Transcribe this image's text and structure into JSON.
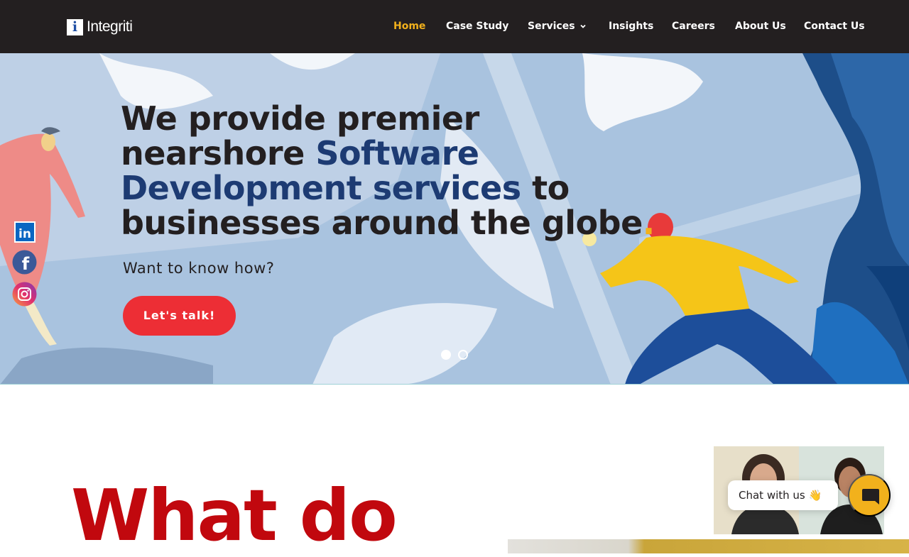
{
  "brand": {
    "logo_letter": "i",
    "name": "Integriti"
  },
  "nav": {
    "items": [
      {
        "label": "Home",
        "active": true
      },
      {
        "label": "Case Study"
      },
      {
        "label": "Services",
        "has_dropdown": true
      },
      {
        "label": "Insights"
      },
      {
        "label": "Careers"
      },
      {
        "label": "About Us"
      },
      {
        "label": "Contact Us"
      }
    ]
  },
  "hero": {
    "headline_a": "We provide premier",
    "headline_b": "nearshore ",
    "headline_hl_1": "Software",
    "headline_hl_2": "Development services",
    "headline_c": " to",
    "headline_d": "businesses around the globe",
    "headline_dot": ".",
    "subheading": "Want to know how?",
    "cta_label": "Let's talk!",
    "slides": 2,
    "active_slide": 1
  },
  "social": [
    {
      "name": "LinkedIn",
      "icon": "linkedin-icon",
      "text": "in"
    },
    {
      "name": "Facebook",
      "icon": "facebook-icon",
      "text": "f"
    },
    {
      "name": "Instagram",
      "icon": "instagram-icon"
    }
  ],
  "section": {
    "title": "What do"
  },
  "chat": {
    "label": "Chat with us",
    "emoji": "👋",
    "icon": "chat-bubble-icon"
  },
  "colors": {
    "nav_bg": "#231f20",
    "nav_active": "#f2b11c",
    "hero_bg": "#a9c3df",
    "headline": "#231f20",
    "headline_highlight": "#1d3b73",
    "cta": "#ed2e35",
    "section_title": "#c1080e",
    "chat_button": "#f2b11c"
  }
}
